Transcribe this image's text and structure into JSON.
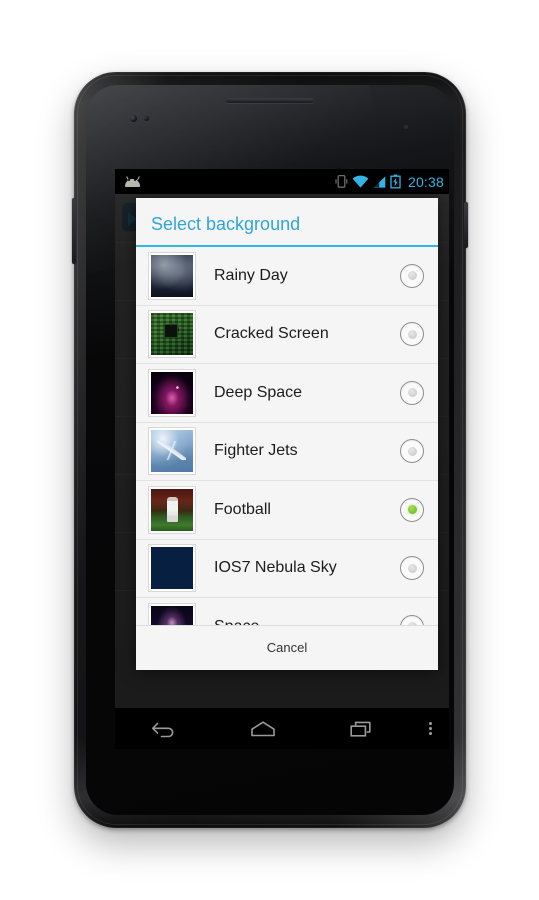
{
  "device": {
    "name": "android-phone-nexus",
    "keys": [
      "power-key",
      "volume-key"
    ]
  },
  "statusbar": {
    "android_icon": "android-head-icon",
    "icons": [
      "vibrate-icon",
      "wifi-icon",
      "cellular-signal-icon",
      "battery-charging-icon"
    ],
    "clock": "20:38",
    "clock_color": "#33b5e5"
  },
  "dialog": {
    "title": "Select background",
    "title_color": "#2fa6d6",
    "accent_color": "#33b5e5",
    "background_color": "#f5f5f5",
    "selected_color": "#7cc534",
    "cancel_label": "Cancel",
    "items": [
      {
        "label": "Rainy Day",
        "thumb": "tb-rainy",
        "thumb_name": "thumbnail-rainy-day",
        "selected": false
      },
      {
        "label": "Cracked Screen",
        "thumb": "tb-cracked",
        "thumb_name": "thumbnail-cracked-screen",
        "selected": false
      },
      {
        "label": "Deep Space",
        "thumb": "tb-deepspace",
        "thumb_name": "thumbnail-deep-space",
        "selected": false
      },
      {
        "label": "Fighter Jets",
        "thumb": "tb-jets",
        "thumb_name": "thumbnail-fighter-jets",
        "selected": false
      },
      {
        "label": "Football",
        "thumb": "tb-football",
        "thumb_name": "thumbnail-football",
        "selected": true
      },
      {
        "label": "IOS7 Nebula Sky",
        "thumb": "tb-nebula",
        "thumb_name": "thumbnail-ios7-nebula-sky",
        "selected": false
      },
      {
        "label": "Space",
        "thumb": "tb-space",
        "thumb_name": "thumbnail-space",
        "selected": false
      }
    ]
  },
  "navbar": {
    "buttons": [
      "back-button",
      "home-button",
      "recents-button",
      "overflow-menu-button"
    ]
  }
}
